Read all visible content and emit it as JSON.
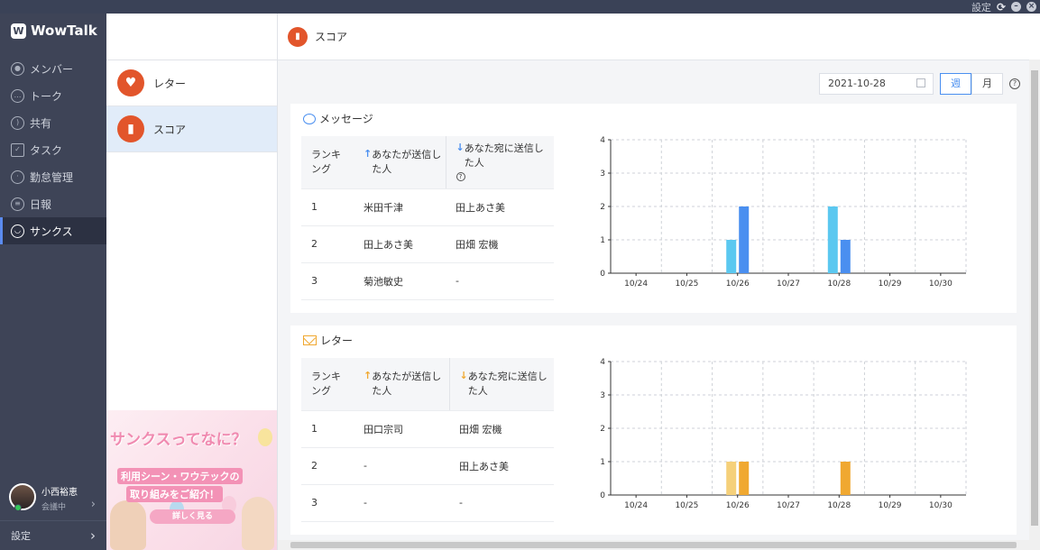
{
  "titlebar": {
    "settings_label": "設定",
    "reload_icon": "reload-icon",
    "minimize_icon": "minimize-icon",
    "close_icon": "close-icon"
  },
  "sidebar": {
    "logo": "WowTalk",
    "items": [
      {
        "label": "メンバー",
        "icon": "person-icon"
      },
      {
        "label": "トーク",
        "icon": "chat-icon"
      },
      {
        "label": "共有",
        "icon": "share-icon"
      },
      {
        "label": "タスク",
        "icon": "clipboard-icon"
      },
      {
        "label": "勤怠管理",
        "icon": "clock-icon"
      },
      {
        "label": "日報",
        "icon": "report-icon"
      },
      {
        "label": "サンクス",
        "icon": "smile-icon"
      }
    ],
    "active_index": 6,
    "user": {
      "name": "小西裕恵",
      "status": "会議中"
    },
    "settings": "設定"
  },
  "list": {
    "items": [
      {
        "label": "レター",
        "icon": "heart-letter-icon"
      },
      {
        "label": "スコア",
        "icon": "bar-chart-icon"
      }
    ],
    "selected_index": 1,
    "banner": {
      "title": "サンクスってなに？",
      "line1": "利用シーン・ワウテックの",
      "line2": "取り組みをご紹介！",
      "button": "詳しく見る"
    }
  },
  "main": {
    "header_title": "スコア",
    "date": "2021-10-28",
    "seg": [
      "週",
      "月"
    ],
    "seg_active": 0
  },
  "message_card": {
    "title": "メッセージ",
    "columns": [
      "ランキング",
      "あなたが送信した人",
      "あなた宛に送信した人"
    ],
    "rows": [
      [
        "1",
        "米田千津",
        "田上あさ美"
      ],
      [
        "2",
        "田上あさ美",
        "田畑 宏機"
      ],
      [
        "3",
        "菊池敏史",
        "-"
      ]
    ]
  },
  "letter_card": {
    "title": "レター",
    "columns": [
      "ランキング",
      "あなたが送信した人",
      "あなた宛に送信した人"
    ],
    "rows": [
      [
        "1",
        "田口宗司",
        "田畑 宏機"
      ],
      [
        "2",
        "-",
        "田上あさ美"
      ],
      [
        "3",
        "-",
        "-"
      ]
    ]
  },
  "chart_data": [
    {
      "type": "bar",
      "categories": [
        "10/24",
        "10/25",
        "10/26",
        "10/27",
        "10/28",
        "10/29",
        "10/30"
      ],
      "series": [
        {
          "values": [
            0,
            0,
            1,
            0,
            2,
            0,
            0
          ],
          "color": "#5bc8f0"
        },
        {
          "values": [
            0,
            0,
            2,
            0,
            1,
            0,
            0
          ],
          "color": "#4a8ff0"
        }
      ],
      "ylim": [
        0,
        4
      ],
      "yticks": [
        0,
        1,
        2,
        3,
        4
      ],
      "grid": true
    },
    {
      "type": "bar",
      "categories": [
        "10/24",
        "10/25",
        "10/26",
        "10/27",
        "10/28",
        "10/29",
        "10/30"
      ],
      "series": [
        {
          "values": [
            0,
            0,
            1,
            0,
            0,
            0,
            0
          ],
          "color": "#f5d07a"
        },
        {
          "values": [
            0,
            0,
            1,
            0,
            1,
            0,
            0
          ],
          "color": "#f0a830"
        }
      ],
      "ylim": [
        0,
        4
      ],
      "yticks": [
        0,
        1,
        2,
        3,
        4
      ],
      "grid": true
    }
  ]
}
